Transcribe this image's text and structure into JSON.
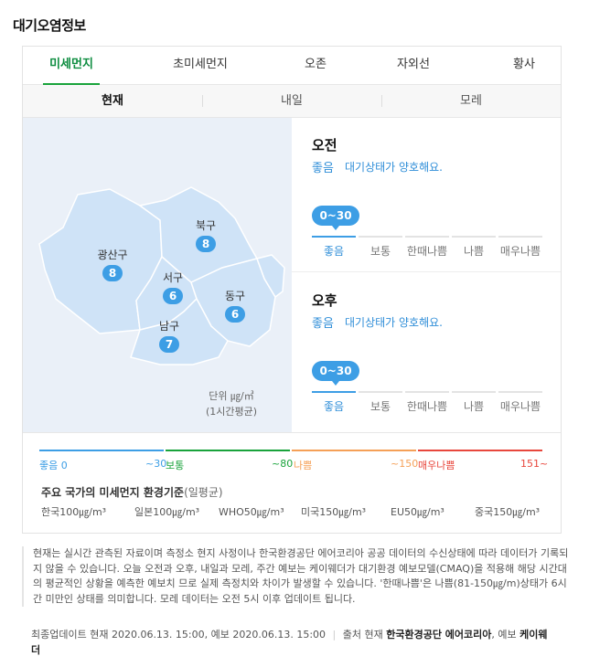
{
  "title": "대기오염정보",
  "tabs": [
    "미세먼지",
    "초미세먼지",
    "오존",
    "자외선",
    "황사"
  ],
  "subtabs": [
    "현재",
    "내일",
    "모레"
  ],
  "map": {
    "districts": [
      {
        "name": "광산구",
        "value": "8"
      },
      {
        "name": "북구",
        "value": "8"
      },
      {
        "name": "서구",
        "value": "6"
      },
      {
        "name": "동구",
        "value": "6"
      },
      {
        "name": "남구",
        "value": "7"
      }
    ],
    "unit_line1": "단위 ㎍/㎥",
    "unit_line2": "(1시간평균)"
  },
  "forecast": [
    {
      "time": "오전",
      "status": "좋음",
      "desc": "대기상태가 양호해요.",
      "range": "0~30"
    },
    {
      "time": "오후",
      "status": "좋음",
      "desc": "대기상태가 양호해요.",
      "range": "0~30"
    }
  ],
  "scale_labels": [
    "좋음",
    "보통",
    "한때나쁨",
    "나쁨",
    "매우나쁨"
  ],
  "legend": [
    {
      "label": "좋음 0",
      "color": "#3d9ee5"
    },
    {
      "label": "~30",
      "color": "#3d9ee5"
    },
    {
      "label": "보통",
      "color": "#19a33b"
    },
    {
      "label": "~80",
      "color": "#19a33b"
    },
    {
      "label": "나쁨",
      "color": "#f5a057"
    },
    {
      "label": "~150",
      "color": "#f5a057"
    },
    {
      "label": "매우나쁨",
      "color": "#e8473d"
    },
    {
      "label": "151~",
      "color": "#e8473d"
    }
  ],
  "standards": {
    "title": "주요 국가의 미세먼지 환경기준",
    "subtitle": "(일평균)",
    "items": [
      "한국100㎍/m³",
      "일본100㎍/m³",
      "WHO50㎍/m³",
      "미국150㎍/m³",
      "EU50㎍/m³",
      "중국150㎍/m³"
    ]
  },
  "footnote": "현재는 실시간 관측된 자료이며 측정소 현지 사정이나 한국환경공단 에어코리아 공공 데이터의 수신상태에 따라 데이터가 기록되지 않을 수 있습니다. 오늘 오전과 오후, 내일과 모레, 주간 예보는 케이웨더가 대기환경 예보모델(CMAQ)을 적용해 해당 시간대의 평균적인 상황을 예측한 예보치 므로 실제 측정치와 차이가 발생할 수 있습니다. '한때나쁨'은 나쁨(81-150㎍/m)상태가 6시간 미만인 상태를 의미합니다. 모레 데이터는 오전 5시 이후 업데이트 됩니다.",
  "update": {
    "text": "최종업데이트 현재 2020.06.13. 15:00, 예보 2020.06.13. 15:00",
    "source_prefix": "출처 현재",
    "source_current": "한국환경공단 에어코리아",
    "source_mid": ", 예보",
    "source_forecast": "케이웨더"
  }
}
